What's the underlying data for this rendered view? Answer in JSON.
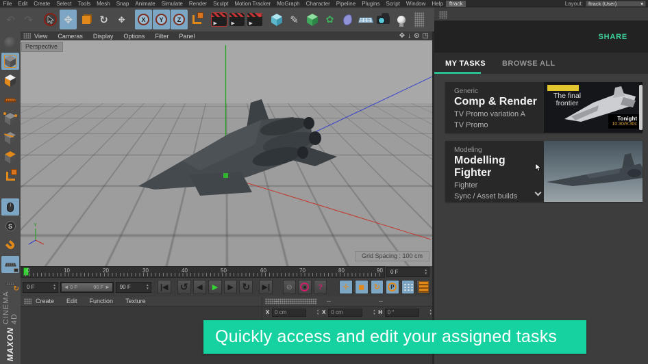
{
  "menubar": {
    "items": [
      "File",
      "Edit",
      "Create",
      "Select",
      "Tools",
      "Mesh",
      "Snap",
      "Animate",
      "Simulate",
      "Render",
      "Sculpt",
      "Motion Tracker",
      "MoGraph",
      "Character",
      "Pipeline",
      "Plugins",
      "Script",
      "Window",
      "Help",
      "ftrack"
    ],
    "layout_label": "Layout:",
    "layout_value": "ftrack (User)",
    "layout_caret": "▾"
  },
  "viewport": {
    "menu": [
      "View",
      "Cameras",
      "Display",
      "Options",
      "Filter",
      "Panel"
    ],
    "camera_label": "Perspective",
    "grid_spacing": "Grid Spacing : 100 cm",
    "controls": [
      "✥",
      "↓",
      "⊙",
      "◳"
    ],
    "axis_y_label": "Y"
  },
  "timeline": {
    "ticks": [
      "0",
      "10",
      "20",
      "30",
      "40",
      "50",
      "60",
      "70",
      "80",
      "90"
    ],
    "frame_display": "0 F"
  },
  "transport": {
    "current": "0 F",
    "range_start": "◄ 0 F",
    "range_end": "90 F ►",
    "end": "90 F",
    "buttons": {
      "goto_start": "|◀",
      "loop_back": "↺",
      "prev": "◀",
      "play": "▶",
      "next": "▶",
      "loop_fwd": "↻",
      "goto_end": "▶|",
      "ghost": "⊘",
      "record": "●",
      "help": "?",
      "move": "✛",
      "scale": "◼",
      "rotate": "↻",
      "pcircle": "P"
    }
  },
  "bottom": {
    "menu": [
      "Create",
      "Edit",
      "Function",
      "Texture"
    ],
    "coord_headers": [
      "--",
      "--",
      "--"
    ],
    "coords": [
      {
        "label": "X",
        "value": "0 cm"
      },
      {
        "label": "X",
        "value": "0 cm"
      },
      {
        "label": "H",
        "value": "0 °"
      }
    ]
  },
  "panel": {
    "share": "SHARE",
    "tabs": [
      "MY TASKS",
      "BROWSE ALL"
    ],
    "tasks": [
      {
        "category": "Generic",
        "title": "Comp & Render",
        "line1": "TV Promo variation A",
        "line2": "TV Promo",
        "thumb": {
          "title": "The final frontier",
          "badge_line1": "Tonight",
          "badge_line2": "10:30/9:30c"
        }
      },
      {
        "category": "Modeling",
        "title": "Modelling Fighter",
        "line1": "Fighter",
        "line2": "Sync / Asset builds"
      }
    ]
  },
  "banner": {
    "text": "Quickly access and edit your assigned tasks"
  },
  "branding": {
    "maxon": "MAXON",
    "cinema": "CINEMA 4D"
  },
  "icons": {
    "undo": "↶",
    "redo": "↷",
    "move": "✥",
    "rotate": "↻",
    "pen": "✎",
    "flower": "✿",
    "x": "X",
    "y": "Y",
    "z": "Z",
    "s": "S",
    "c": "C"
  },
  "colors": {
    "banner": "#16d2a0",
    "share": "#3ed59b",
    "tab_underline": "#2abf90",
    "record": "#cf1d6a",
    "tool_orange": "#e2891b",
    "tool_blue": "#7da6c4",
    "play": "#35d435"
  }
}
